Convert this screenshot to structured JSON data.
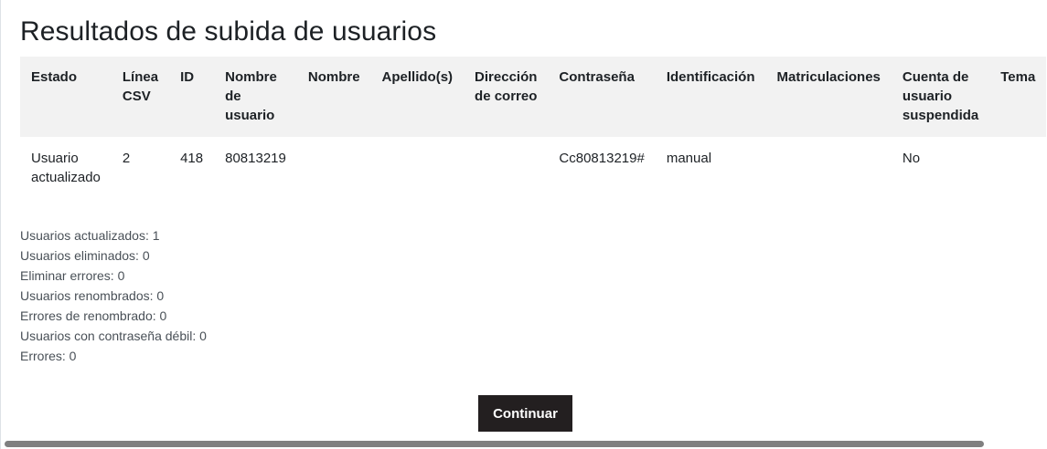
{
  "page_title": "Resultados de subida de usuarios",
  "table": {
    "headers": [
      [
        "Estado"
      ],
      [
        "Línea",
        "CSV"
      ],
      [
        "ID"
      ],
      [
        "Nombre",
        "de",
        "usuario"
      ],
      [
        "Nombre"
      ],
      [
        "Apellido(s)"
      ],
      [
        "Dirección",
        "de correo"
      ],
      [
        "Contraseña"
      ],
      [
        "Identificación"
      ],
      [
        "Matriculaciones"
      ],
      [
        "Cuenta de",
        "usuario",
        "suspendida"
      ],
      [
        "Tema"
      ]
    ],
    "rows": [
      [
        [
          "Usuario",
          "actualizado"
        ],
        [
          "2"
        ],
        [
          "418"
        ],
        [
          "80813219"
        ],
        [
          ""
        ],
        [
          ""
        ],
        [
          ""
        ],
        [
          "Cc80813219#"
        ],
        [
          "manual"
        ],
        [
          ""
        ],
        [
          "No"
        ],
        [
          ""
        ]
      ]
    ]
  },
  "summary": [
    "Usuarios actualizados: 1",
    "Usuarios eliminados: 0",
    "Eliminar errores: 0",
    "Usuarios renombrados: 0",
    "Errores de renombrado: 0",
    "Usuarios con contraseña débil: 0",
    "Errores: 0"
  ],
  "continue_button": "Continuar"
}
